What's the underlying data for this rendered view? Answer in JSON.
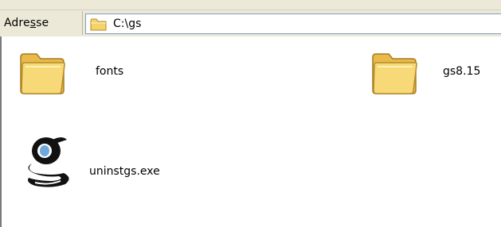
{
  "address_bar": {
    "label": "Adresse",
    "label_access_key": "s",
    "path": "C:\\gs",
    "folder_icon": "folder-icon"
  },
  "files": [
    {
      "name": "fonts",
      "icon": "folder-icon"
    },
    {
      "name": "gs8.15",
      "icon": "folder-icon"
    },
    {
      "name": "uninstgs.exe",
      "icon": "ghostscript-app-icon"
    }
  ],
  "colors": {
    "toolbar_bg": "#ece9d8",
    "content_bg": "#ffffff",
    "folder_yellow": "#f5d36a",
    "field_border": "#7f9db9"
  }
}
